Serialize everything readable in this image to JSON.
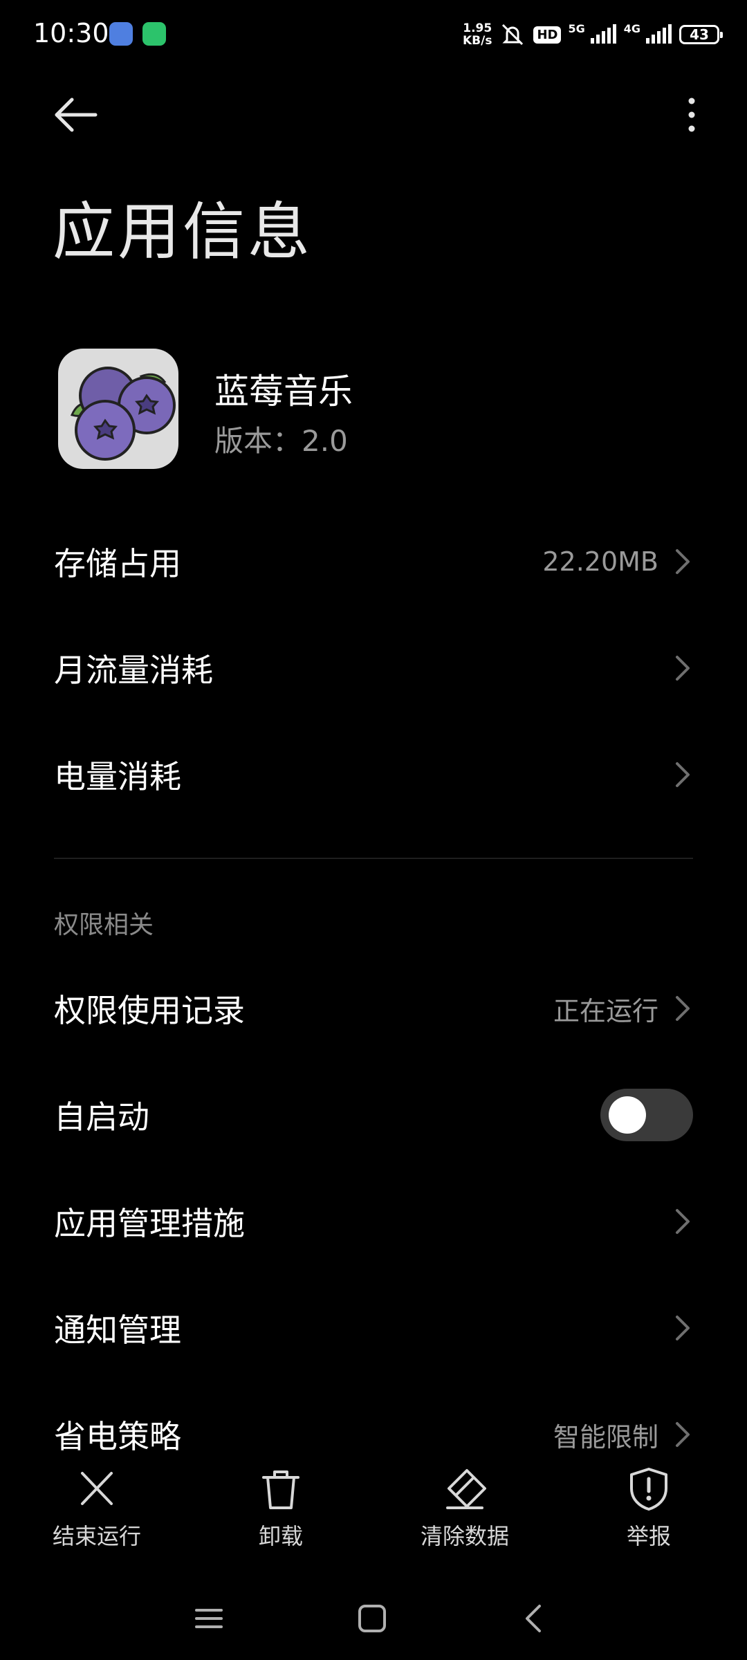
{
  "status_bar": {
    "time": "10:30",
    "net_speed_value": "1.95",
    "net_speed_unit": "KB/s",
    "hd_badge": "HD",
    "signal1_label": "5G",
    "signal2_label": "4G",
    "battery": "43"
  },
  "header": {
    "title": "应用信息"
  },
  "app": {
    "name": "蓝莓音乐",
    "version": "版本：2.0"
  },
  "rows_top": [
    {
      "label": "存储占用",
      "value": "22.20MB"
    },
    {
      "label": "月流量消耗",
      "value": ""
    },
    {
      "label": "电量消耗",
      "value": ""
    }
  ],
  "permissions": {
    "section_label": "权限相关",
    "usage_record": {
      "label": "权限使用记录",
      "value": "正在运行"
    },
    "autostart": {
      "label": "自启动",
      "enabled": false
    },
    "app_management": {
      "label": "应用管理措施"
    },
    "notifications": {
      "label": "通知管理"
    },
    "power_saving": {
      "label": "省电策略",
      "value": "智能限制"
    }
  },
  "actions": [
    {
      "label": "结束运行",
      "icon": "close-icon"
    },
    {
      "label": "卸载",
      "icon": "trash-icon"
    },
    {
      "label": "清除数据",
      "icon": "eraser-icon"
    },
    {
      "label": "举报",
      "icon": "shield-alert-icon"
    }
  ],
  "nav": [
    "menu-icon",
    "home-icon",
    "back-icon"
  ]
}
